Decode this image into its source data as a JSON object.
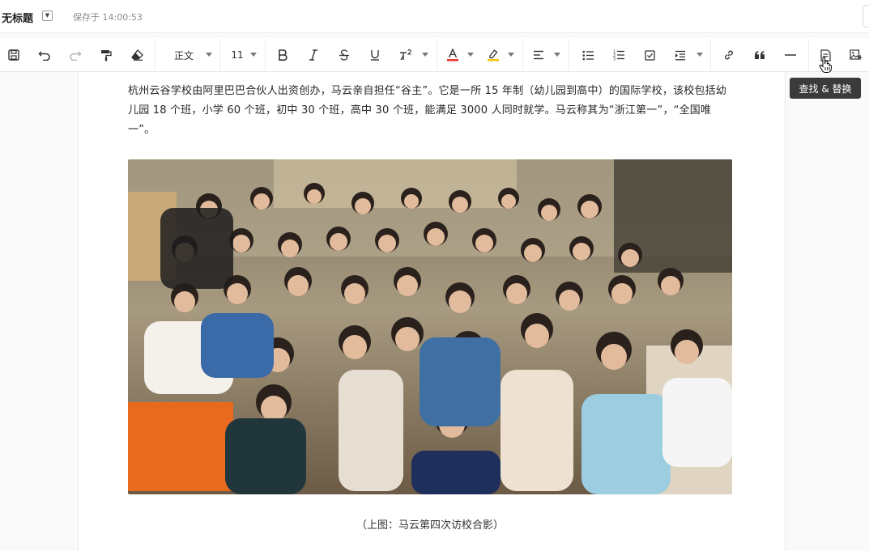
{
  "header": {
    "doc_title": "无标题",
    "save_status": "保存于 14:00:53"
  },
  "toolbar": {
    "paragraph_style": "正文",
    "font_size": "11",
    "font_color": "#e53935",
    "highlight_color": "#f5c518",
    "icons": [
      "save-icon",
      "undo-icon",
      "redo-icon",
      "format-painter-icon",
      "clear-format-icon",
      "bold-icon",
      "italic-icon",
      "strikethrough-icon",
      "underline-icon",
      "superscript-icon",
      "font-color-icon",
      "highlight-icon",
      "align-icon",
      "bullet-list-icon",
      "numbered-list-icon",
      "checklist-icon",
      "indent-icon",
      "link-icon",
      "quote-icon",
      "divider-icon",
      "find-replace-icon",
      "insert-image-icon"
    ]
  },
  "tooltip": {
    "text": "查找 & 替换"
  },
  "content": {
    "paragraph": "杭州云谷学校由阿里巴巴合伙人出资创办，马云亲自担任“谷主”。它是一所 15 年制（幼儿园到高中）的国际学校，该校包括幼儿园 18 个班，小学 60 个班，初中 30 个班，高中 30 个班，能满足 3000 人同时就学。马云称其为“浙江第一”，“全国唯一”。",
    "caption": "（上图：马云第四次访校合影）"
  }
}
